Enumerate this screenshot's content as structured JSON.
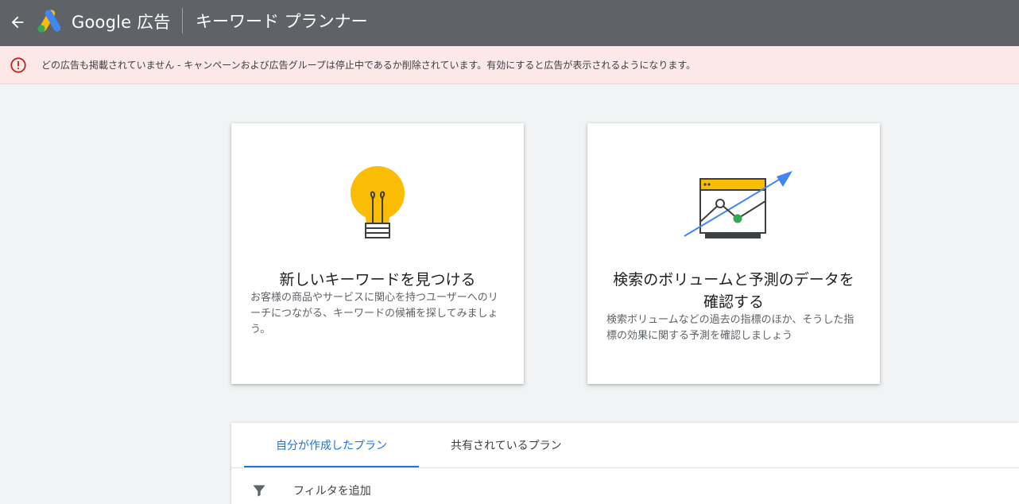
{
  "header": {
    "brand": "Google 広告",
    "page_title": "キーワード プランナー",
    "background": "#5f6368"
  },
  "alert": {
    "message": "どの広告も掲載されていません - キャンペーンおよび広告グループは停止中であるか削除されています。有効にすると広告が表示されるようになります。",
    "background": "#fce8e6",
    "icon_color": "#c5221f"
  },
  "cards": [
    {
      "icon": "lightbulb-icon",
      "title": "新しいキーワードを見つける",
      "description": "お客様の商品やサービスに関心を持つユーザーへのリーチにつながる、キーワードの候補を探してみましょう。"
    },
    {
      "icon": "forecast-chart-icon",
      "title": "検索のボリュームと予測のデータを確認する",
      "description": "検索ボリュームなどの過去の指標のほか、そうした指標の効果に関する予測を確認しましょう"
    }
  ],
  "plans": {
    "tabs": [
      {
        "label": "自分が作成したプラン",
        "active": true
      },
      {
        "label": "共有されているプラン",
        "active": false
      }
    ],
    "filter_label": "フィルタを追加"
  },
  "colors": {
    "accent": "#1a73e8",
    "bulb": "#fbbc04",
    "chart_arrow": "#4285f4",
    "chart_point": "#34a853"
  }
}
